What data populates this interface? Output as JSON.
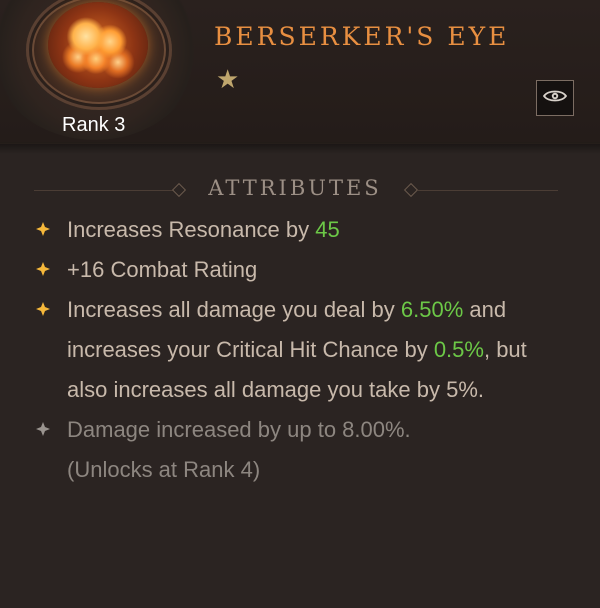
{
  "item": {
    "name": "Berserker's Eye",
    "rank": "Rank 3",
    "stars": 1
  },
  "colors": {
    "title": "#e88f41",
    "highlight": "#6cc847",
    "text": "#c8b9ab",
    "muted": "#8d8680",
    "bullet_active": "#f6b83b",
    "bullet_inactive": "#9a948f"
  },
  "section": {
    "title": "Attributes"
  },
  "attributes": [
    {
      "prefix": "Increases Resonance by ",
      "value": "45",
      "suffix": ""
    },
    {
      "value": "+16",
      "suffix": " Combat Rating"
    },
    {
      "prefix": "Increases all damage you deal by ",
      "value1": "6.50%",
      "middle": " and increases your Critical Hit Chance by ",
      "value2": "0.5%",
      "suffix": ", but also increases all damage you take by 5%."
    },
    {
      "text": "Damage increased by up to 8.00%.",
      "unlock": "(Unlocks at Rank 4)"
    }
  ],
  "icons": {
    "gem": "berserkers-eye-gem-icon",
    "star": "star-icon",
    "eye": "eye-icon",
    "bullet": "diamond-bullet-icon"
  }
}
